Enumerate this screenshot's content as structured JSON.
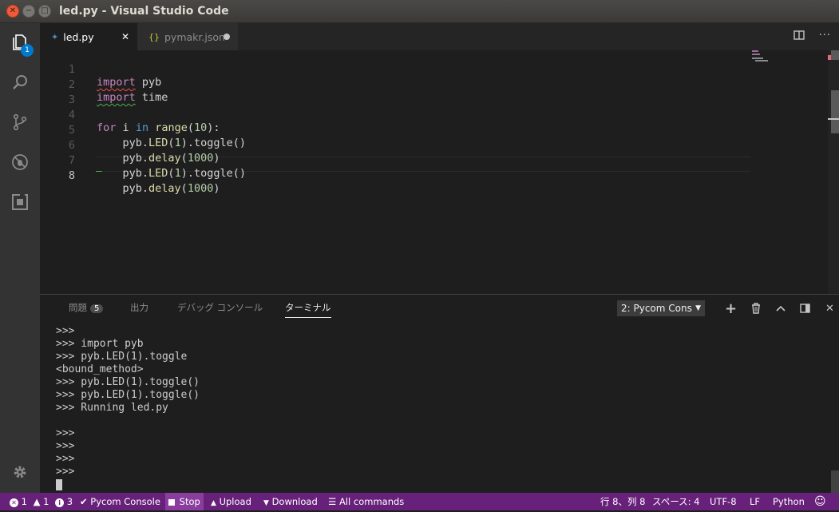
{
  "window": {
    "title": "led.py - Visual Studio Code"
  },
  "activity_bar": {
    "explorer_badge": "1"
  },
  "tabs": [
    {
      "label": "led.py",
      "icon": "python-file-icon"
    },
    {
      "label": "pymakr.json",
      "icon": "json-file-icon"
    }
  ],
  "editor": {
    "lines": [
      {
        "n": "1"
      },
      {
        "n": "2"
      },
      {
        "n": "3"
      },
      {
        "n": "4"
      },
      {
        "n": "5"
      },
      {
        "n": "6"
      },
      {
        "n": "7"
      },
      {
        "n": "8"
      }
    ],
    "tokens": {
      "import": "import",
      "pyb": "pyb",
      "time": "time",
      "for": "for",
      "i": "i",
      "in": "in",
      "range": "range",
      "ten": "10",
      "lparen": "(",
      "rparen": ")",
      "colon": ":",
      "pyb_dot": "pyb.",
      "LED": "LED",
      "one": "1",
      "toggle_call": ".toggle()",
      "delay": "delay",
      "thousand": "1000"
    }
  },
  "panel": {
    "tabs": [
      {
        "label": "問題",
        "badge": "5"
      },
      {
        "label": "出力"
      },
      {
        "label": "デバッグ コンソール"
      },
      {
        "label": "ターミナル"
      }
    ],
    "terminal_select": "2: Pycom Cons",
    "terminal_lines": [
      ">>>",
      ">>> import pyb",
      ">>> pyb.LED(1).toggle",
      "<bound_method>",
      ">>> pyb.LED(1).toggle()",
      ">>> pyb.LED(1).toggle()",
      ">>> Running led.py",
      "",
      ">>>",
      ">>>",
      ">>>",
      ">>>"
    ]
  },
  "statusbar": {
    "errors": "1",
    "warnings": "1",
    "infos": "3",
    "pycom_console": "Pycom Console",
    "stop": "Stop",
    "upload": "Upload",
    "download": "Download",
    "all_commands": "All commands",
    "position": "行 8、列 8",
    "spaces": "スペース: 4",
    "encoding": "UTF-8",
    "eol": "LF",
    "language": "Python"
  },
  "colors": {
    "accent": "#68217a",
    "badge": "#007acc"
  }
}
